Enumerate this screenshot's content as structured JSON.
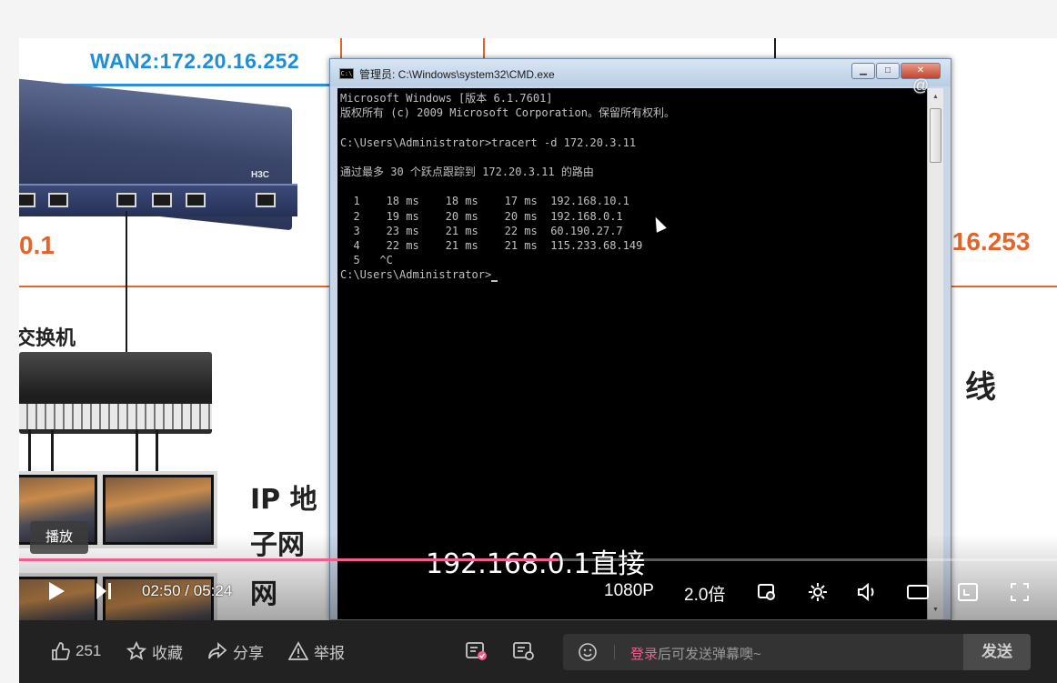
{
  "video": {
    "slide": {
      "wan_label": "WAN2:172.20.16.252",
      "ip_left": "0.1",
      "ip_right": ".16.253",
      "switch_label": "交换机",
      "right_text": "线",
      "ip_text_line1": "IP 地",
      "ip_text_line2": "子网",
      "ip_text_line3": "网"
    },
    "cmd": {
      "title": "管理员: C:\\Windows\\system32\\CMD.exe",
      "buttons": {
        "minimize": "▁",
        "maximize": "□",
        "close": "✕"
      },
      "lines": [
        "Microsoft Windows [版本 6.1.7601]",
        "版权所有 (c) 2009 Microsoft Corporation。保留所有权利。",
        "",
        "C:\\Users\\Administrator>tracert -d 172.20.3.11",
        "",
        "通过最多 30 个跃点跟踪到 172.20.3.11 的路由",
        "",
        "  1    18 ms    18 ms    17 ms  192.168.10.1",
        "  2    19 ms    20 ms    20 ms  192.168.0.1",
        "  3    23 ms    21 ms    22 ms  60.190.27.7",
        "  4    22 ms    21 ms    21 ms  115.233.68.149",
        "  5   ^C",
        "C:\\Users\\Administrator>"
      ]
    },
    "watermark": "@",
    "subtitle": "192.168.0.1直接",
    "tooltip": "播放",
    "progress_fraction": 0.52,
    "controls": {
      "current_time": "02:50",
      "separator": "/",
      "total_time": "05:24",
      "quality": "1080P",
      "speed": "2.0倍"
    }
  },
  "bottom_bar": {
    "like_count": "251",
    "favorite_label": "收藏",
    "share_label": "分享",
    "report_label": "举报",
    "danmaku_login": "登录",
    "danmaku_placeholder": "后可发送弹幕噢~",
    "send_label": "发送"
  },
  "colors": {
    "accent_pink": "#f25d8e",
    "slide_blue": "#1e8fd6",
    "slide_orange": "#e2642b",
    "bar_bg": "#222222"
  }
}
